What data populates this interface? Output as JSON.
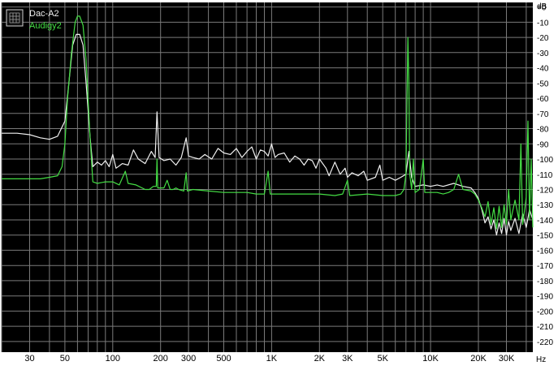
{
  "chart_data": {
    "type": "line",
    "y_unit": "dB",
    "x_unit": "Hz",
    "x_scale": "log",
    "grid": true,
    "background": "#000000",
    "grid_color": "#7a7a7a",
    "legend_position": "top-left",
    "legend_icon": "spectrum-grid-icon",
    "xlim": [
      20,
      44000
    ],
    "ylim": [
      -227,
      3
    ],
    "x_ticks": [
      {
        "value": 30,
        "label": "30"
      },
      {
        "value": 50,
        "label": "50"
      },
      {
        "value": 100,
        "label": "100"
      },
      {
        "value": 200,
        "label": "200"
      },
      {
        "value": 300,
        "label": "300"
      },
      {
        "value": 500,
        "label": "500"
      },
      {
        "value": 1000,
        "label": "1K"
      },
      {
        "value": 2000,
        "label": "2K"
      },
      {
        "value": 3000,
        "label": "3K"
      },
      {
        "value": 5000,
        "label": "5K"
      },
      {
        "value": 10000,
        "label": "10K"
      },
      {
        "value": 20000,
        "label": "20K"
      },
      {
        "value": 30000,
        "label": "30K"
      }
    ],
    "y_ticks": [
      {
        "value": 0,
        "label": "+0"
      },
      {
        "value": -10,
        "label": "-10"
      },
      {
        "value": -20,
        "label": "-20"
      },
      {
        "value": -30,
        "label": "-30"
      },
      {
        "value": -40,
        "label": "-40"
      },
      {
        "value": -50,
        "label": "-50"
      },
      {
        "value": -60,
        "label": "-60"
      },
      {
        "value": -70,
        "label": "-70"
      },
      {
        "value": -80,
        "label": "-80"
      },
      {
        "value": -90,
        "label": "-90"
      },
      {
        "value": -100,
        "label": "-100"
      },
      {
        "value": -110,
        "label": "-110"
      },
      {
        "value": -120,
        "label": "-120"
      },
      {
        "value": -130,
        "label": "-130"
      },
      {
        "value": -140,
        "label": "-140"
      },
      {
        "value": -150,
        "label": "-150"
      },
      {
        "value": -160,
        "label": "-160"
      },
      {
        "value": -170,
        "label": "-170"
      },
      {
        "value": -180,
        "label": "-180"
      },
      {
        "value": -190,
        "label": "-190"
      },
      {
        "value": -200,
        "label": "-200"
      },
      {
        "value": -210,
        "label": "-210"
      },
      {
        "value": -220,
        "label": "-220"
      }
    ],
    "series": [
      {
        "name": "Dac-A2",
        "color": "#f0f0f0",
        "points": [
          [
            20,
            -83
          ],
          [
            25,
            -83
          ],
          [
            30,
            -84
          ],
          [
            35,
            -86
          ],
          [
            40,
            -87
          ],
          [
            45,
            -85
          ],
          [
            50,
            -75
          ],
          [
            53,
            -50
          ],
          [
            56,
            -25
          ],
          [
            59,
            -18
          ],
          [
            62,
            -18
          ],
          [
            65,
            -25
          ],
          [
            68,
            -50
          ],
          [
            72,
            -85
          ],
          [
            75,
            -105
          ],
          [
            80,
            -102
          ],
          [
            85,
            -104
          ],
          [
            90,
            -101
          ],
          [
            95,
            -105
          ],
          [
            100,
            -97
          ],
          [
            105,
            -106
          ],
          [
            115,
            -103
          ],
          [
            125,
            -104
          ],
          [
            135,
            -94
          ],
          [
            145,
            -100
          ],
          [
            160,
            -103
          ],
          [
            175,
            -95
          ],
          [
            185,
            -99
          ],
          [
            190,
            -69
          ],
          [
            196,
            -99
          ],
          [
            210,
            -101
          ],
          [
            230,
            -100
          ],
          [
            250,
            -104
          ],
          [
            270,
            -99
          ],
          [
            290,
            -86
          ],
          [
            300,
            -98
          ],
          [
            320,
            -99
          ],
          [
            350,
            -100
          ],
          [
            380,
            -97
          ],
          [
            420,
            -100
          ],
          [
            460,
            -93
          ],
          [
            500,
            -96
          ],
          [
            550,
            -97
          ],
          [
            600,
            -93
          ],
          [
            650,
            -99
          ],
          [
            700,
            -95
          ],
          [
            750,
            -92
          ],
          [
            800,
            -100
          ],
          [
            850,
            -94
          ],
          [
            900,
            -95
          ],
          [
            950,
            -98
          ],
          [
            1000,
            -90
          ],
          [
            1050,
            -99
          ],
          [
            1100,
            -97
          ],
          [
            1200,
            -96
          ],
          [
            1300,
            -102
          ],
          [
            1400,
            -98
          ],
          [
            1500,
            -100
          ],
          [
            1600,
            -104
          ],
          [
            1700,
            -100
          ],
          [
            1800,
            -101
          ],
          [
            1900,
            -106
          ],
          [
            2000,
            -100
          ],
          [
            2200,
            -106
          ],
          [
            2300,
            -111
          ],
          [
            2500,
            -102
          ],
          [
            2700,
            -110
          ],
          [
            2900,
            -106
          ],
          [
            3000,
            -112
          ],
          [
            3200,
            -109
          ],
          [
            3500,
            -111
          ],
          [
            3800,
            -108
          ],
          [
            4000,
            -114
          ],
          [
            4500,
            -112
          ],
          [
            4800,
            -104
          ],
          [
            5000,
            -114
          ],
          [
            5500,
            -112
          ],
          [
            6000,
            -114
          ],
          [
            6500,
            -112
          ],
          [
            7000,
            -110
          ],
          [
            7300,
            -95
          ],
          [
            7600,
            -112
          ],
          [
            8000,
            -118
          ],
          [
            9000,
            -117
          ],
          [
            10000,
            -118
          ],
          [
            11000,
            -117
          ],
          [
            12000,
            -118
          ],
          [
            14000,
            -116
          ],
          [
            16000,
            -118
          ],
          [
            18000,
            -119
          ],
          [
            19000,
            -122
          ],
          [
            20000,
            -126
          ],
          [
            21000,
            -133
          ],
          [
            22000,
            -142
          ],
          [
            23000,
            -138
          ],
          [
            24000,
            -146
          ],
          [
            25000,
            -140
          ],
          [
            26000,
            -150
          ],
          [
            27000,
            -142
          ],
          [
            28000,
            -149
          ],
          [
            29000,
            -139
          ],
          [
            30000,
            -150
          ],
          [
            31000,
            -141
          ],
          [
            32000,
            -147
          ],
          [
            34000,
            -139
          ],
          [
            36000,
            -149
          ],
          [
            38000,
            -136
          ],
          [
            40000,
            -145
          ],
          [
            42000,
            -133
          ],
          [
            44000,
            -140
          ]
        ]
      },
      {
        "name": "Audigy2",
        "color": "#44dd44",
        "points": [
          [
            20,
            -113
          ],
          [
            25,
            -113
          ],
          [
            30,
            -113
          ],
          [
            35,
            -113
          ],
          [
            40,
            -112
          ],
          [
            45,
            -111
          ],
          [
            48,
            -105
          ],
          [
            50,
            -90
          ],
          [
            52,
            -60
          ],
          [
            55,
            -30
          ],
          [
            58,
            -10
          ],
          [
            60,
            -6
          ],
          [
            62,
            -6
          ],
          [
            65,
            -12
          ],
          [
            68,
            -35
          ],
          [
            72,
            -85
          ],
          [
            75,
            -115
          ],
          [
            80,
            -116
          ],
          [
            90,
            -115
          ],
          [
            100,
            -115
          ],
          [
            110,
            -117
          ],
          [
            120,
            -108
          ],
          [
            125,
            -116
          ],
          [
            140,
            -117
          ],
          [
            160,
            -120
          ],
          [
            170,
            -120
          ],
          [
            180,
            -118
          ],
          [
            188,
            -118
          ],
          [
            190,
            -100
          ],
          [
            192,
            -119
          ],
          [
            210,
            -119
          ],
          [
            220,
            -114
          ],
          [
            230,
            -120
          ],
          [
            240,
            -120
          ],
          [
            250,
            -119
          ],
          [
            260,
            -120
          ],
          [
            280,
            -121
          ],
          [
            290,
            -109
          ],
          [
            295,
            -121
          ],
          [
            320,
            -120
          ],
          [
            400,
            -121
          ],
          [
            500,
            -122
          ],
          [
            600,
            -122
          ],
          [
            700,
            -122
          ],
          [
            800,
            -123
          ],
          [
            900,
            -123
          ],
          [
            950,
            -108
          ],
          [
            980,
            -123
          ],
          [
            1000,
            -123
          ],
          [
            1500,
            -123
          ],
          [
            2000,
            -123
          ],
          [
            2500,
            -124
          ],
          [
            2800,
            -123
          ],
          [
            3000,
            -114
          ],
          [
            3100,
            -124
          ],
          [
            4000,
            -123
          ],
          [
            5000,
            -124
          ],
          [
            6000,
            -124
          ],
          [
            6500,
            -123
          ],
          [
            6800,
            -120
          ],
          [
            7000,
            -110
          ],
          [
            7200,
            -20
          ],
          [
            7300,
            -50
          ],
          [
            7400,
            -110
          ],
          [
            7600,
            -120
          ],
          [
            7800,
            -100
          ],
          [
            8000,
            -122
          ],
          [
            8500,
            -120
          ],
          [
            9000,
            -100
          ],
          [
            9200,
            -122
          ],
          [
            10000,
            -122
          ],
          [
            11000,
            -122
          ],
          [
            12000,
            -123
          ],
          [
            13000,
            -122
          ],
          [
            14000,
            -120
          ],
          [
            15000,
            -110
          ],
          [
            16000,
            -120
          ],
          [
            18000,
            -121
          ],
          [
            19000,
            -123
          ],
          [
            20000,
            -127
          ],
          [
            21000,
            -132
          ],
          [
            22000,
            -138
          ],
          [
            23000,
            -128
          ],
          [
            24000,
            -143
          ],
          [
            25000,
            -132
          ],
          [
            26000,
            -146
          ],
          [
            27000,
            -131
          ],
          [
            28000,
            -145
          ],
          [
            29000,
            -130
          ],
          [
            30000,
            -143
          ],
          [
            31000,
            -120
          ],
          [
            32000,
            -140
          ],
          [
            34000,
            -127
          ],
          [
            36000,
            -140
          ],
          [
            37000,
            -90
          ],
          [
            38000,
            -143
          ],
          [
            40000,
            -125
          ],
          [
            41000,
            -75
          ],
          [
            42000,
            -140
          ],
          [
            43000,
            -100
          ],
          [
            44000,
            -145
          ]
        ]
      }
    ]
  }
}
